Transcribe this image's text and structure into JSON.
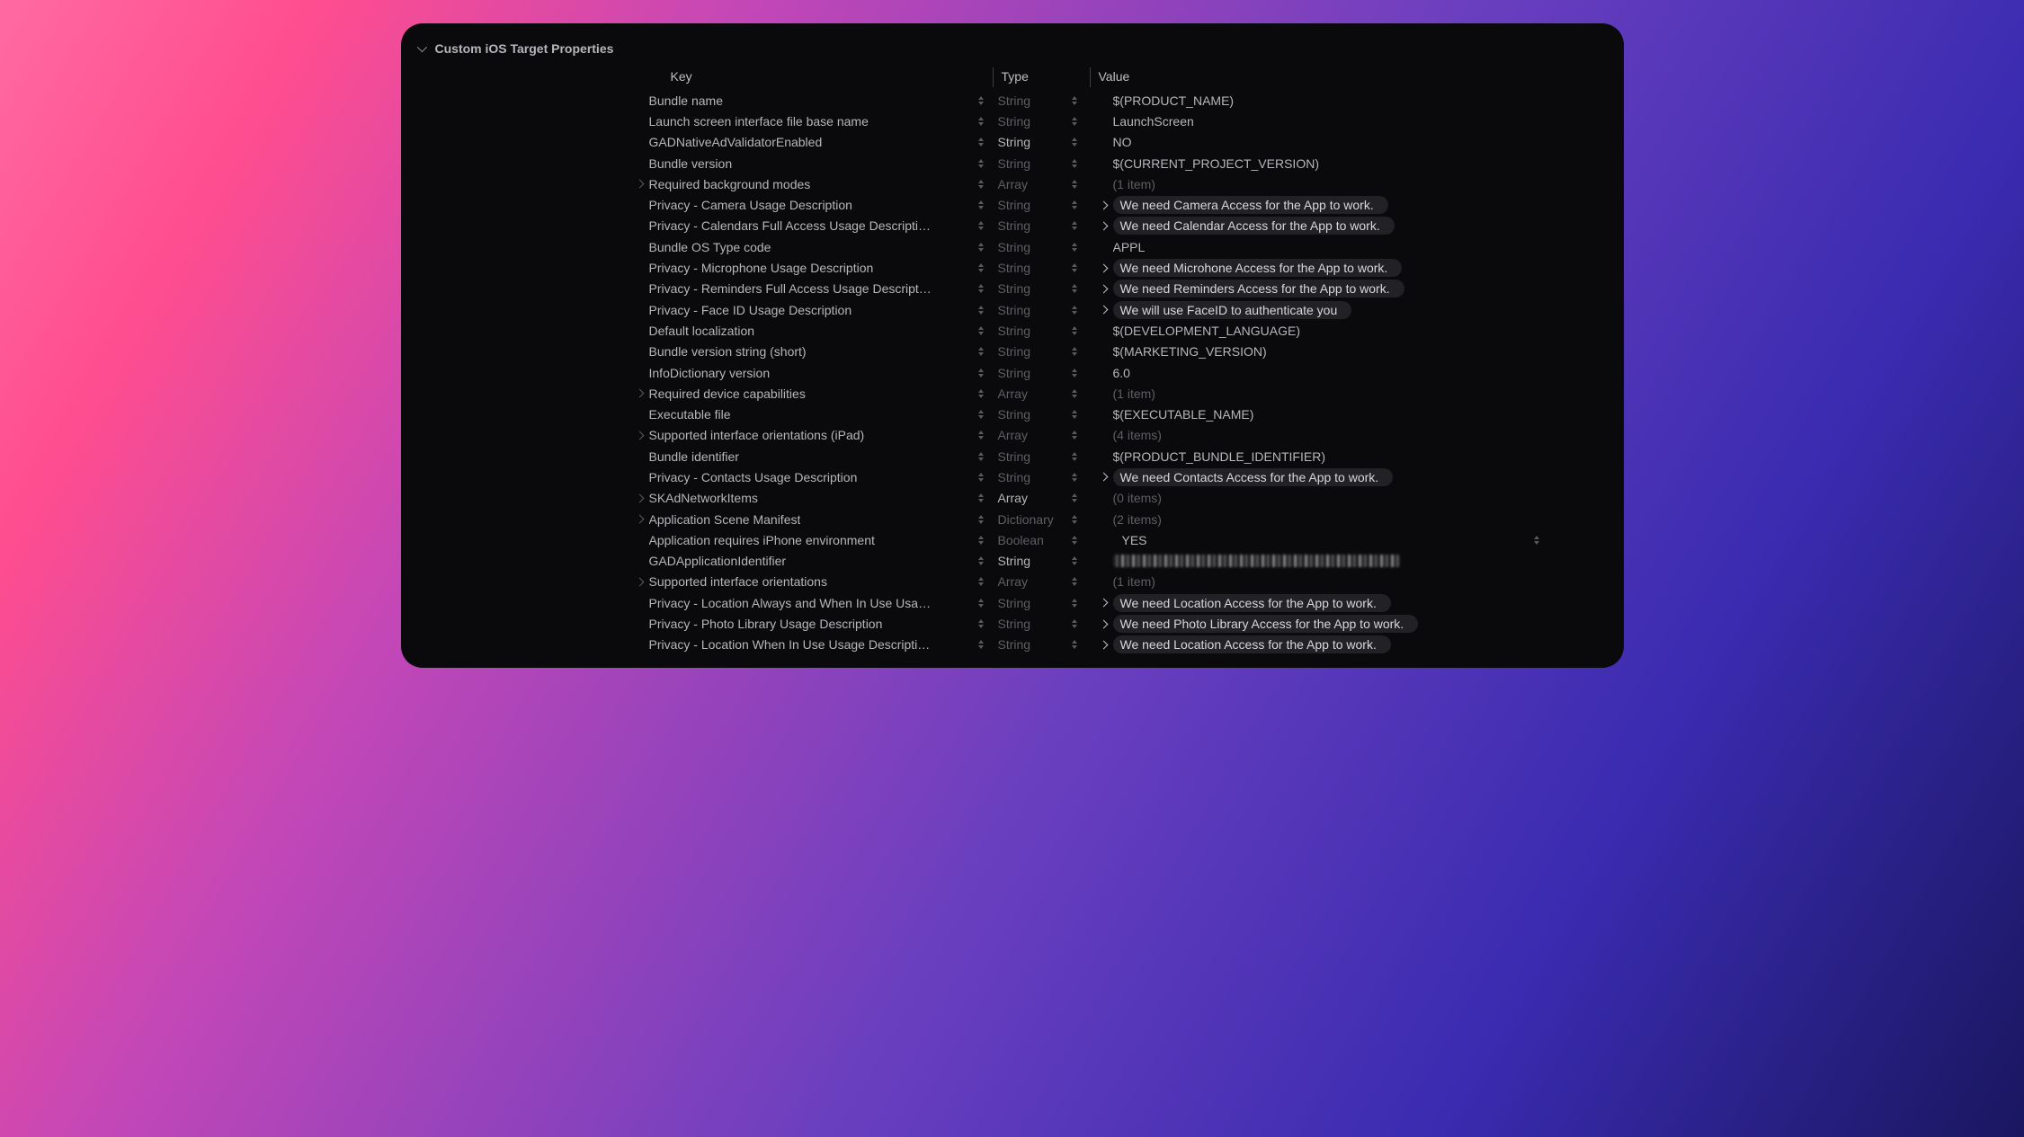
{
  "header": {
    "title": "Custom iOS Target Properties"
  },
  "columns": {
    "key": "Key",
    "type": "Type",
    "value": "Value"
  },
  "rows": [
    {
      "key": "Bundle name",
      "type": "String",
      "typeBright": false,
      "value": "$(PRODUCT_NAME)"
    },
    {
      "key": "Launch screen interface file base name",
      "type": "String",
      "typeBright": false,
      "value": "LaunchScreen"
    },
    {
      "key": "GADNativeAdValidatorEnabled",
      "type": "String",
      "typeBright": true,
      "value": "NO"
    },
    {
      "key": "Bundle version",
      "type": "String",
      "typeBright": false,
      "value": "$(CURRENT_PROJECT_VERSION)"
    },
    {
      "key": "Required background modes",
      "expandable": true,
      "type": "Array",
      "typeBright": false,
      "value": "(1 item)",
      "valueDim": true
    },
    {
      "key": "Privacy - Camera Usage Description",
      "type": "String",
      "typeBright": false,
      "value": "We need Camera Access for the App to work.",
      "highlighted": true,
      "valueChevron": true
    },
    {
      "key": "Privacy - Calendars Full Access Usage Descripti…",
      "type": "String",
      "typeBright": false,
      "value": "We need Calendar Access for the App to work.",
      "highlighted": true,
      "valueChevron": true
    },
    {
      "key": "Bundle OS Type code",
      "type": "String",
      "typeBright": false,
      "value": "APPL"
    },
    {
      "key": "Privacy - Microphone Usage Description",
      "type": "String",
      "typeBright": false,
      "value": "We need Microhone Access for the App to work.",
      "highlighted": true,
      "valueChevron": true
    },
    {
      "key": "Privacy - Reminders Full Access Usage Descript…",
      "type": "String",
      "typeBright": false,
      "value": "We need Reminders Access for the App to work.",
      "highlighted": true,
      "valueChevron": true
    },
    {
      "key": "Privacy - Face ID Usage Description",
      "type": "String",
      "typeBright": false,
      "value": "We will use FaceID to authenticate you",
      "highlighted": true,
      "valueChevron": true
    },
    {
      "key": "Default localization",
      "type": "String",
      "typeBright": false,
      "value": "$(DEVELOPMENT_LANGUAGE)"
    },
    {
      "key": "Bundle version string (short)",
      "type": "String",
      "typeBright": false,
      "value": "$(MARKETING_VERSION)"
    },
    {
      "key": "InfoDictionary version",
      "type": "String",
      "typeBright": false,
      "value": "6.0"
    },
    {
      "key": "Required device capabilities",
      "expandable": true,
      "type": "Array",
      "typeBright": false,
      "value": "(1 item)",
      "valueDim": true
    },
    {
      "key": "Executable file",
      "type": "String",
      "typeBright": false,
      "value": "$(EXECUTABLE_NAME)"
    },
    {
      "key": "Supported interface orientations (iPad)",
      "expandable": true,
      "type": "Array",
      "typeBright": false,
      "value": "(4 items)",
      "valueDim": true
    },
    {
      "key": "Bundle identifier",
      "type": "String",
      "typeBright": false,
      "value": "$(PRODUCT_BUNDLE_IDENTIFIER)"
    },
    {
      "key": "Privacy - Contacts Usage Description",
      "type": "String",
      "typeBright": false,
      "value": "We need Contacts Access for the App to work.",
      "highlighted": true,
      "valueChevron": true
    },
    {
      "key": "SKAdNetworkItems",
      "expandable": true,
      "type": "Array",
      "typeBright": true,
      "value": "(0 items)",
      "valueDim": true
    },
    {
      "key": "Application Scene Manifest",
      "expandable": true,
      "type": "Dictionary",
      "typeBright": false,
      "value": "(2 items)",
      "valueDim": true
    },
    {
      "key": "Application requires iPhone environment",
      "type": "Boolean",
      "typeBright": false,
      "value": "YES",
      "boolStepper": true
    },
    {
      "key": "GADApplicationIdentifier",
      "type": "String",
      "typeBright": true,
      "value": "",
      "obscured": true
    },
    {
      "key": "Supported interface orientations",
      "expandable": true,
      "type": "Array",
      "typeBright": false,
      "value": "(1 item)",
      "valueDim": true
    },
    {
      "key": "Privacy - Location Always and When In Use Usa…",
      "type": "String",
      "typeBright": false,
      "value": "We need Location Access for the App to work.",
      "highlighted": true,
      "valueChevron": true
    },
    {
      "key": "Privacy - Photo Library Usage Description",
      "type": "String",
      "typeBright": false,
      "value": "We need Photo Library Access for the App to work.",
      "highlighted": true,
      "valueChevron": true
    },
    {
      "key": "Privacy - Location When In Use Usage Descripti…",
      "type": "String",
      "typeBright": false,
      "value": "We need Location Access for the App to work.",
      "highlighted": true,
      "valueChevron": true
    }
  ]
}
